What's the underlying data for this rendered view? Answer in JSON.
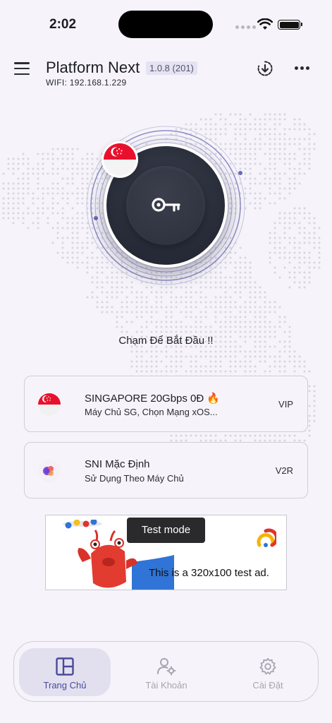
{
  "status_bar": {
    "time": "2:02"
  },
  "header": {
    "title": "Platform Next",
    "version": "1.0.8 (201)",
    "wifi_ip": "WIFI: 192.168.1.229"
  },
  "connect": {
    "prompt": "Chạm Để Bắt Đầu !!"
  },
  "server_card": {
    "title": "SINGAPORE 20Gbps 0Đ 🔥",
    "subtitle": "Máy Chủ SG, Chọn Mạng xOS...",
    "tag": "VIP"
  },
  "sni_card": {
    "title": "SNI Mặc Định",
    "subtitle": "Sử Dụng Theo Máy Chủ",
    "tag": "V2R"
  },
  "ad": {
    "badge": "Test mode",
    "text": "This is a 320x100 test ad."
  },
  "bottom_nav": {
    "items": [
      {
        "label": "Trang Chủ",
        "active": true
      },
      {
        "label": "Tài Khoản",
        "active": false
      },
      {
        "label": "Cài Đặt",
        "active": false
      }
    ]
  },
  "colors": {
    "background": "#f6f4fa",
    "accent": "#4a4a9a",
    "orb": "#262a36",
    "flag_red": "#e8112d"
  },
  "icons": {
    "menu": "menu-icon",
    "download": "download-icon",
    "more": "more-icon",
    "key": "key-icon",
    "home": "dashboard-icon",
    "account": "user-settings-icon",
    "settings": "gear-icon"
  }
}
